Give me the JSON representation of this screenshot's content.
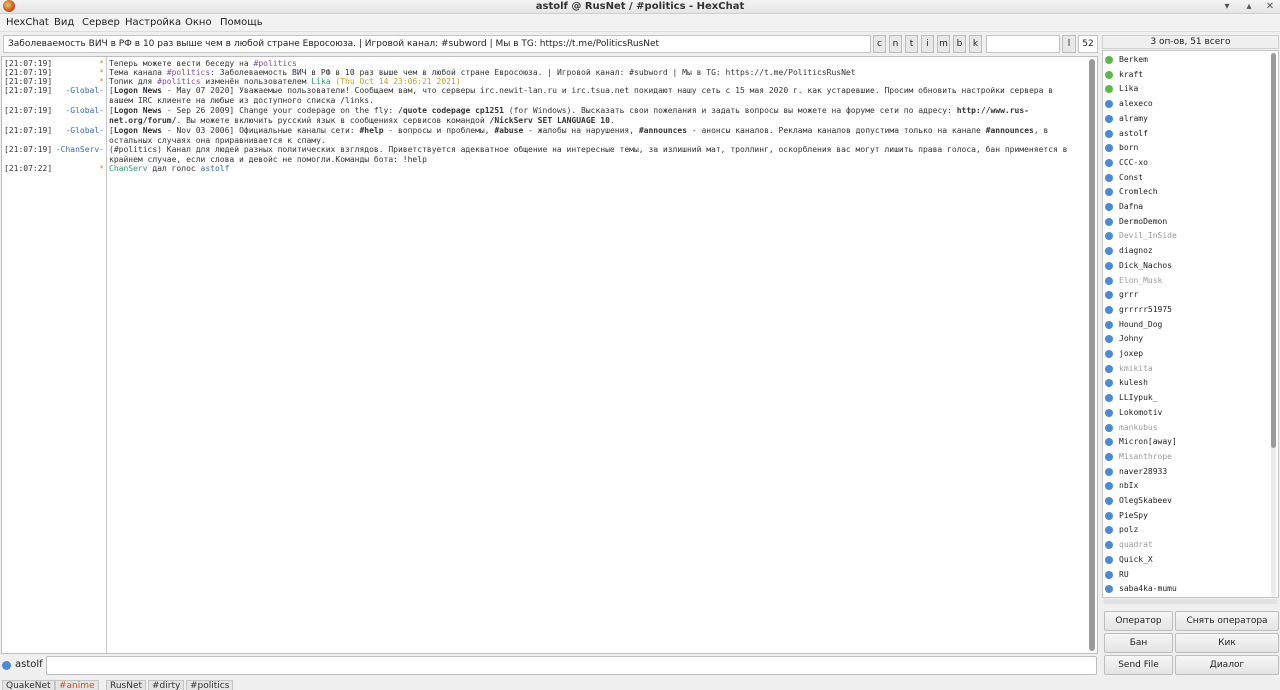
{
  "window": {
    "title": "astolf @ RusNet / #politics - HexChat"
  },
  "menu": [
    "HexChat",
    "Вид",
    "Сервер",
    "Настройка",
    "Окно",
    "Помощь"
  ],
  "topic": "Заболеваемость ВИЧ в РФ в 10 раз выше чем в любой стране Евросоюза. | Игровой канал: #subword | Мы в TG: https://t.me/PoliticsRusNet",
  "mode_buttons": [
    "c",
    "n",
    "t",
    "i",
    "m",
    "b",
    "k"
  ],
  "limit_button": "l",
  "user_count_box": "52",
  "user_header": "3 оп-ов, 51 всего",
  "chat": [
    {
      "ts": "[21:07:19]",
      "nick": "*",
      "nick_class": "nick-star",
      "html": "Теперь можете вести беседу на <span class=\"c-chan\">#politics</span>"
    },
    {
      "ts": "[21:07:19]",
      "nick": "*",
      "nick_class": "nick-star",
      "html": "Тема канала <span class=\"c-chan\">#politics</span>: Заболеваемость ВИЧ в РФ в 10 раз выше чем в любой стране Евросоюза. | Игровой канал: #subword | Мы в TG: https://t.me/PoliticsRusNet"
    },
    {
      "ts": "[21:07:19]",
      "nick": "*",
      "nick_class": "nick-star",
      "html": "Топик для <span class=\"c-chan\">#politics</span> изменён пользователем <span class=\"c-green\">Lika</span> <span class=\"c-gold\">(Thu Oct 14 23:06:21 2021)</span>"
    },
    {
      "ts": "[21:07:19]",
      "nick": "-Global-",
      "nick_class": "nick-global",
      "html": "[<span class=\"b\">Logon News</span> - May 07 2020] Уважаемые пользователи! Сообщаем вам, что серверы irc.newit-lan.ru и irc.tsua.net покидают нашу сеть с 15 мая 2020 г. как устаревшие. Просим обновить настройки сервера в вашем IRC клиенте на любые из доступного списка /links."
    },
    {
      "ts": "[21:07:19]",
      "nick": "-Global-",
      "nick_class": "nick-global",
      "html": "[<span class=\"b\">Logon News</span> - Sep 26 2009] Change your codepage on the fly: <span class=\"b\">/quote codepage cp1251</span> (for Windows). Высказать свои пожелания и задать вопросы вы можете на форуме сети по адресу: <span class=\"b\">http://www.rus-net.org/forum/</span>. Вы можете включить русский язык в сообщениях сервисов командой <span class=\"b\">/NickServ SET LANGUAGE 10</span>."
    },
    {
      "ts": "[21:07:19]",
      "nick": "-Global-",
      "nick_class": "nick-global",
      "html": "[<span class=\"b\">Logon News</span> - Nov 03 2006] Официальные каналы сети: <span class=\"b\">#help</span> - вопросы и проблемы, <span class=\"b\">#abuse</span> - жалобы на нарушения, <span class=\"b\">#announces</span> - анонсы каналов. Реклама каналов допустима только на канале <span class=\"b\">#announces</span>, в остальных случаях она приравнивается к спаму."
    },
    {
      "ts": "[21:07:19]",
      "nick": "-ChanServ-",
      "nick_class": "nick-chanserv",
      "html": "(#politics) Канал для людей разных политических взглядов. Приветствуется адекватное общение на интересные темы, за излишний мат, троллинг, оскорбления вас могут лишить права голоса, бан применяется в крайнем случае, если слова и девойс не помогли.Команды бота: !help"
    },
    {
      "ts": "[21:07:22]",
      "nick": "*",
      "nick_class": "nick-star",
      "html": "<span class=\"c-green\">ChanServ</span> дал голос <span class=\"c-blue\">astolf</span>"
    }
  ],
  "self_nick": "astolf",
  "tabs": [
    {
      "label": "QuakeNet",
      "hl": false
    },
    {
      "label": "#anime",
      "hl": true
    },
    {
      "label": "RusNet",
      "hl": false
    },
    {
      "label": "#dirty",
      "hl": false
    },
    {
      "label": "#politics",
      "hl": false
    }
  ],
  "colors": {
    "op": "#5cb84a",
    "voice": "#4a8ad6"
  },
  "users": [
    {
      "name": "Berkem",
      "status": "op",
      "away": false
    },
    {
      "name": "kraft",
      "status": "op",
      "away": false
    },
    {
      "name": "Lika",
      "status": "op",
      "away": false
    },
    {
      "name": "alexeco",
      "status": "voice",
      "away": false
    },
    {
      "name": "alramy",
      "status": "voice",
      "away": false
    },
    {
      "name": "astolf",
      "status": "voice",
      "away": false
    },
    {
      "name": "born",
      "status": "voice",
      "away": false
    },
    {
      "name": "CCC-xo",
      "status": "voice",
      "away": false
    },
    {
      "name": "Const",
      "status": "voice",
      "away": false
    },
    {
      "name": "Cromlech",
      "status": "voice",
      "away": false
    },
    {
      "name": "Dafna",
      "status": "voice",
      "away": false
    },
    {
      "name": "DermoDemon",
      "status": "voice",
      "away": false
    },
    {
      "name": "Devil_InSide",
      "status": "voice",
      "away": true
    },
    {
      "name": "diagnoz",
      "status": "voice",
      "away": false
    },
    {
      "name": "Dick_Nachos",
      "status": "voice",
      "away": false
    },
    {
      "name": "Elon_Musk",
      "status": "voice",
      "away": true
    },
    {
      "name": "grrr",
      "status": "voice",
      "away": false
    },
    {
      "name": "grrrrr51975",
      "status": "voice",
      "away": false
    },
    {
      "name": "Hound_Dog",
      "status": "voice",
      "away": false
    },
    {
      "name": "Johny",
      "status": "voice",
      "away": false
    },
    {
      "name": "joxep",
      "status": "voice",
      "away": false
    },
    {
      "name": "kmikita",
      "status": "voice",
      "away": true
    },
    {
      "name": "kulesh",
      "status": "voice",
      "away": false
    },
    {
      "name": "LLIypuk_",
      "status": "voice",
      "away": false
    },
    {
      "name": "Lokomotiv",
      "status": "voice",
      "away": false
    },
    {
      "name": "mankubus",
      "status": "voice",
      "away": true
    },
    {
      "name": "Micron[away]",
      "status": "voice",
      "away": false
    },
    {
      "name": "Misanthrope",
      "status": "voice",
      "away": true
    },
    {
      "name": "naver28933",
      "status": "voice",
      "away": false
    },
    {
      "name": "nbIx",
      "status": "voice",
      "away": false
    },
    {
      "name": "OlegSkabeev",
      "status": "voice",
      "away": false
    },
    {
      "name": "PieSpy",
      "status": "voice",
      "away": false
    },
    {
      "name": "polz",
      "status": "voice",
      "away": false
    },
    {
      "name": "quadrat",
      "status": "voice",
      "away": true
    },
    {
      "name": "Quick_X",
      "status": "voice",
      "away": false
    },
    {
      "name": "RU",
      "status": "voice",
      "away": false
    },
    {
      "name": "saba4ka-mumu",
      "status": "voice",
      "away": false
    }
  ],
  "user_buttons": {
    "op": "Оператор",
    "deop": "Снять оператора",
    "ban": "Бан",
    "kick": "Кик",
    "send_file": "Send File",
    "dialog": "Диалог"
  }
}
